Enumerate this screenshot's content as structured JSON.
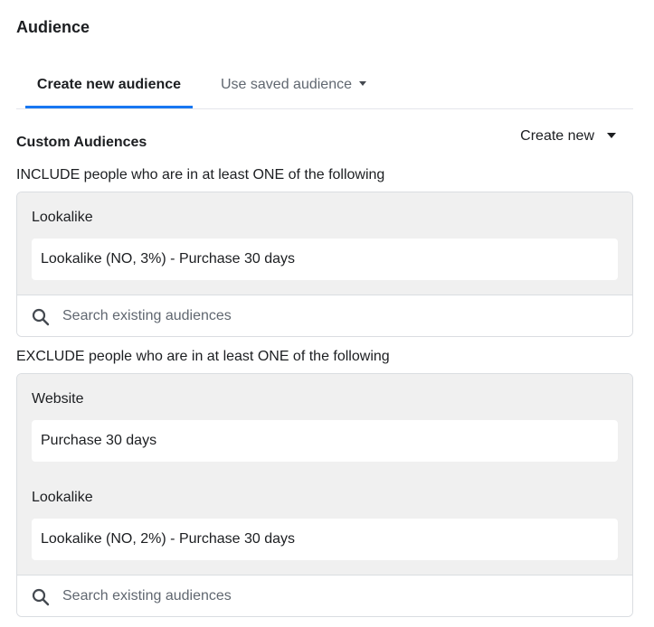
{
  "section": {
    "title": "Audience"
  },
  "tabs": [
    {
      "label": "Create new audience",
      "active": true
    },
    {
      "label": "Use saved audience",
      "active": false
    }
  ],
  "custom_audiences": {
    "label": "Custom Audiences",
    "create_new_label": "Create new",
    "include": {
      "rule_text": "INCLUDE people who are in at least ONE of the following",
      "groups": [
        {
          "label": "Lookalike",
          "audiences": [
            "Lookalike (NO, 3%) - Purchase 30 days"
          ]
        }
      ],
      "search_placeholder": "Search existing audiences"
    },
    "exclude": {
      "rule_text": "EXCLUDE people who are in at least ONE of the following",
      "groups": [
        {
          "label": "Website",
          "audiences": [
            "Purchase 30 days"
          ]
        },
        {
          "label": "Lookalike",
          "audiences": [
            "Lookalike (NO, 2%) - Purchase 30 days"
          ]
        }
      ],
      "search_placeholder": "Search existing audiences"
    }
  },
  "colors": {
    "accent": "#1877f2",
    "panel_gray": "#f0f0f0",
    "border": "#dadde1"
  },
  "icons": {
    "search": "search-icon",
    "dropdown": "chevron-down-icon"
  }
}
